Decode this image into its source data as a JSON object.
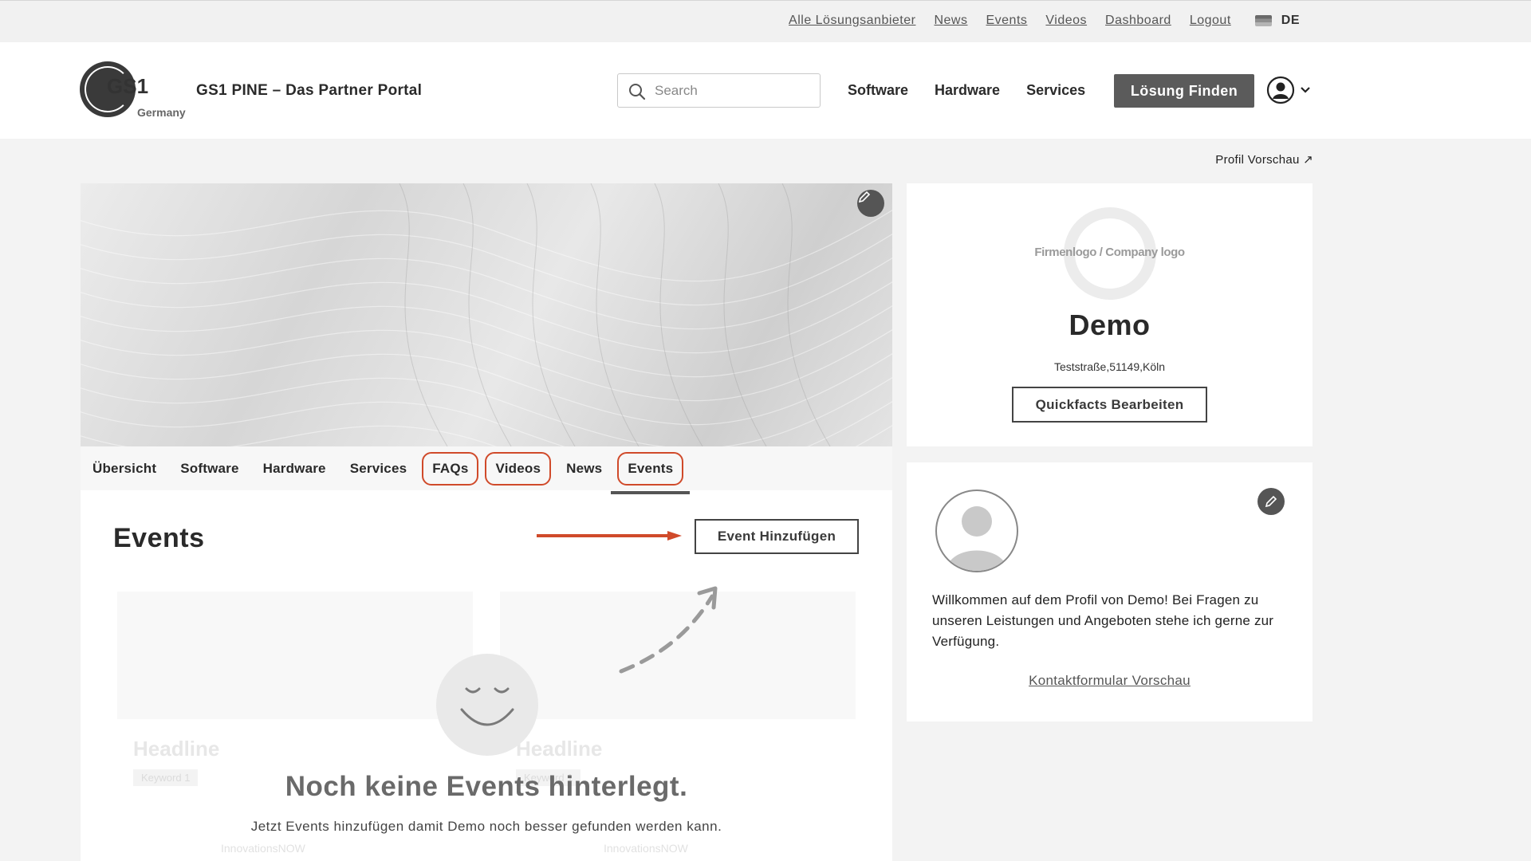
{
  "topbar": {
    "links": [
      "Alle Lösungsanbieter",
      "News",
      "Events",
      "Videos",
      "Dashboard",
      "Logout"
    ],
    "language": "DE"
  },
  "header": {
    "logo_text": "GS1",
    "logo_country": "Germany",
    "portal_title": "GS1 PINE – Das Partner Portal",
    "search_placeholder": "Search",
    "nav": [
      "Software",
      "Hardware",
      "Services"
    ],
    "cta_label": "Lösung Finden"
  },
  "profile_preview_label": "Profil Vorschau ↗",
  "profile_tabs": [
    {
      "label": "Übersicht"
    },
    {
      "label": "Software"
    },
    {
      "label": "Hardware"
    },
    {
      "label": "Services"
    },
    {
      "label": "FAQs"
    },
    {
      "label": "Videos"
    },
    {
      "label": "News"
    },
    {
      "label": "Events"
    }
  ],
  "events": {
    "title": "Events",
    "add_button": "Event Hinzufügen",
    "ghost_headline": "Headline",
    "ghost_keyword": "Keyword 1",
    "ghost_source": "InnovationsNOW",
    "empty_title": "Noch keine Events hinterlegt.",
    "empty_subtitle": "Jetzt Events hinzufügen damit Demo noch besser gefunden werden kann."
  },
  "company_card": {
    "logo_placeholder": "Firmenlogo / Company logo",
    "name": "Demo",
    "address": "Teststraße,51149,Köln",
    "quickfacts_button": "Quickfacts Bearbeiten"
  },
  "contact_card": {
    "welcome_text": "Willkommen auf dem Profil von Demo! Bei Fragen zu unseren Leistungen und Angeboten stehe ich gerne zur Verfügung.",
    "contact_link": "Kontaktformular Vorschau"
  },
  "colors": {
    "highlight": "#d04a2a",
    "button_dark": "#5b5b5b"
  }
}
